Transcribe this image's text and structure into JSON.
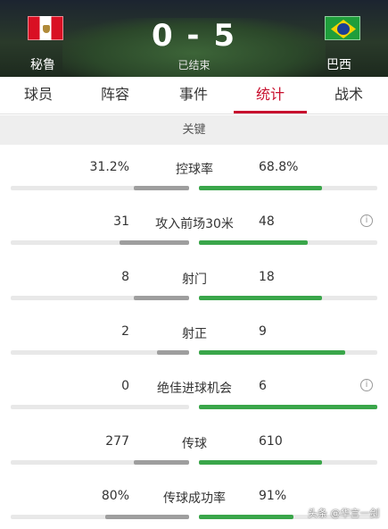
{
  "match": {
    "home_team": "秘鲁",
    "away_team": "巴西",
    "score": "0 - 5",
    "status": "已结束",
    "home_flag_icon": "peru-flag-icon",
    "away_flag_icon": "brazil-flag-icon"
  },
  "tabs": [
    {
      "label": "球员",
      "active": false
    },
    {
      "label": "阵容",
      "active": false
    },
    {
      "label": "事件",
      "active": false
    },
    {
      "label": "统计",
      "active": true
    },
    {
      "label": "战术",
      "active": false
    }
  ],
  "section": {
    "title": "关键"
  },
  "stats": [
    {
      "label": "控球率",
      "left": "31.2%",
      "right": "68.8%",
      "left_fraction": 0.312,
      "right_fraction": 0.688,
      "info": false
    },
    {
      "label": "攻入前场30米",
      "left": "31",
      "right": "48",
      "left_fraction": 0.39,
      "right_fraction": 0.61,
      "info": true
    },
    {
      "label": "射门",
      "left": "8",
      "right": "18",
      "left_fraction": 0.31,
      "right_fraction": 0.69,
      "info": false
    },
    {
      "label": "射正",
      "left": "2",
      "right": "9",
      "left_fraction": 0.18,
      "right_fraction": 0.82,
      "info": false
    },
    {
      "label": "绝佳进球机会",
      "left": "0",
      "right": "6",
      "left_fraction": 0.0,
      "right_fraction": 1.0,
      "info": true
    },
    {
      "label": "传球",
      "left": "277",
      "right": "610",
      "left_fraction": 0.31,
      "right_fraction": 0.69,
      "info": false
    },
    {
      "label": "传球成功率",
      "left": "80%",
      "right": "91%",
      "left_fraction": 0.47,
      "right_fraction": 0.53,
      "info": false
    }
  ],
  "info_glyph": "i",
  "watermark": "头条 @华言一剑",
  "colors": {
    "accent": "#c8102e",
    "away_bar": "#3aa64a",
    "home_bar": "#9e9e9e"
  }
}
